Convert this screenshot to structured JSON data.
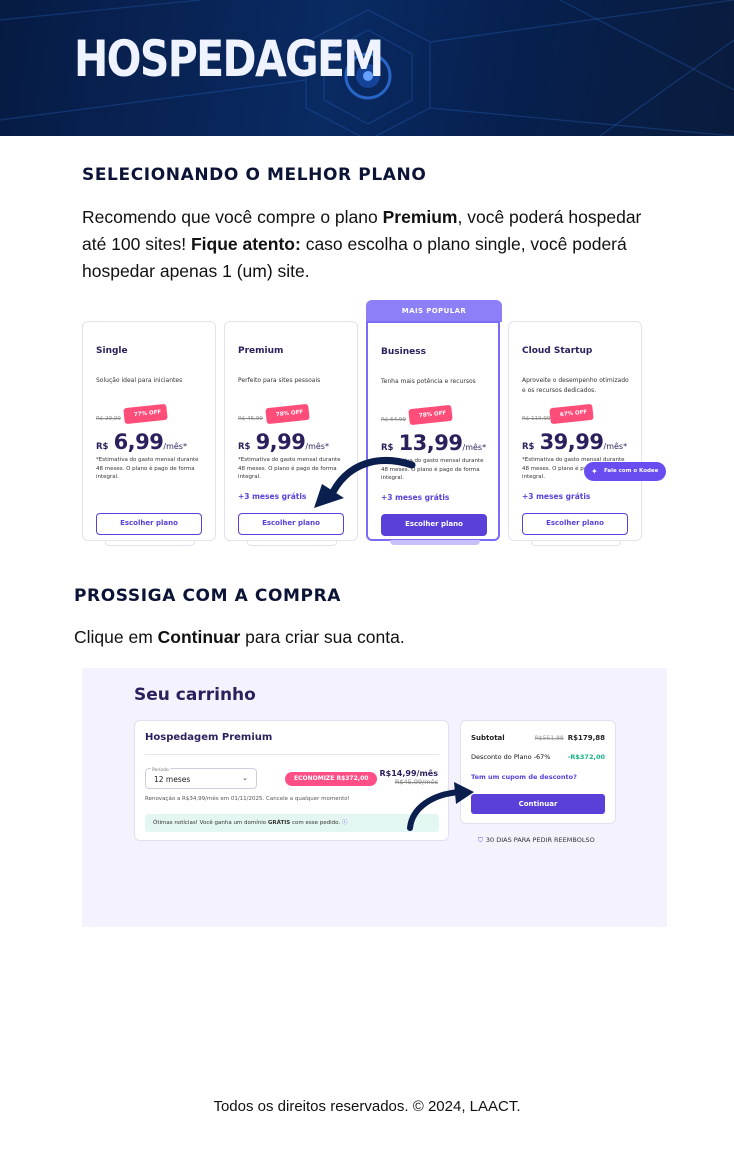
{
  "banner": {
    "title": "HOSPEDAGEM"
  },
  "section1": {
    "heading": "SELECIONANDO O MELHOR PLANO",
    "line1_a": "Recomendo que você compre o plano ",
    "line1_b": "Premium",
    "line1_c": ", você poderá hospedar",
    "line2_a": "até 100 sites! ",
    "line2_b": "Fique atento:",
    "line2_c": " caso escolha o plano single, você poderá",
    "line3": "hospedar apenas 1 (um) site."
  },
  "plans": {
    "popular_tag": "MAIS POPULAR",
    "chat_pill": "Fale com o Kodee",
    "cards": [
      {
        "name": "Single",
        "desc": "Solução ideal para iniciantes",
        "old": "R$ 29,99",
        "off": "77% OFF",
        "cur": "R$",
        "price": "6,99",
        "per": "/mês*",
        "estimate": "*Estimativa do gasto mensal durante 48 meses. O plano é pago de forma integral.",
        "bonus": "",
        "button": "Escolher plano"
      },
      {
        "name": "Premium",
        "desc": "Perfeito para sites pessoais",
        "old": "R$ 45,99",
        "off": "78% OFF",
        "cur": "R$",
        "price": "9,99",
        "per": "/mês*",
        "estimate": "*Estimativa do gasto mensal durante 48 meses. O plano é pago de forma integral.",
        "bonus": "+3 meses grátis",
        "button": "Escolher plano"
      },
      {
        "name": "Business",
        "desc": "Tenha mais potência e recursos",
        "old": "R$ 64,99",
        "off": "78% OFF",
        "cur": "R$",
        "price": "13,99",
        "per": "/mês*",
        "estimate": "*Estimativa do gasto mensal durante 48 meses. O plano é pago de forma integral.",
        "bonus": "+3 meses grátis",
        "button": "Escolher plano"
      },
      {
        "name": "Cloud Startup",
        "desc": "Aproveite o desempenho otimizado e os recursos dedicados.",
        "old": "R$ 119,99",
        "off": "67% OFF",
        "cur": "R$",
        "price": "39,99",
        "per": "/mês*",
        "estimate": "*Estimativa do gasto mensal durante 48 meses. O plano é pago de forma integral.",
        "bonus": "+3 meses grátis",
        "button": "Escolher plano"
      }
    ]
  },
  "section2": {
    "heading": "PROSSIGA COM A COMPRA",
    "text_a": "Clique em ",
    "text_b": "Continuar",
    "text_c": " para criar sua conta."
  },
  "cart": {
    "title": "Seu carrinho",
    "product": "Hospedagem Premium",
    "period_label": "Período",
    "period_value": "12 meses",
    "save_badge": "ECONOMIZE R$372,00",
    "price_now": "R$14,99/mês",
    "price_was": "R$45,99/mês",
    "renewal": "Renovação a R$34,99/mês em 01/11/2025. Cancele a qualquer momento!",
    "note_a": "Ótimas notícias! Você ganha um domínio ",
    "note_b": "GRÁTIS",
    "note_c": " com esse pedido.",
    "subtotal_label": "Subtotal",
    "subtotal_old": "R$551,88",
    "subtotal_new": "R$179,88",
    "discount_label": "Desconto do Plano -67%",
    "discount_value": "-R$372,00",
    "coupon": "Tem um cupom de desconto?",
    "continue": "Continuar",
    "refund": "30 DIAS PARA PEDIR REEMBOLSO"
  },
  "footer": "Todos os direitos reservados. © 2024, LAACT."
}
